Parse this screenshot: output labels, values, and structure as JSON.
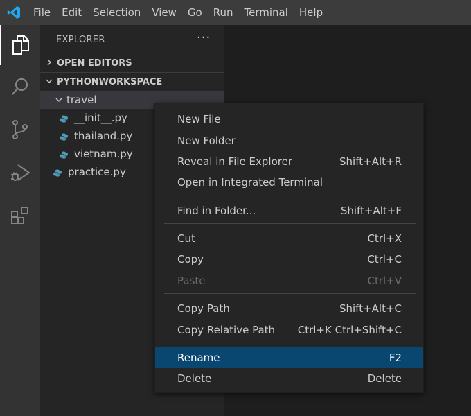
{
  "menubar": {
    "items": [
      "File",
      "Edit",
      "Selection",
      "View",
      "Go",
      "Run",
      "Terminal",
      "Help"
    ]
  },
  "activity_bar": {
    "icons": [
      "files-icon",
      "search-icon",
      "source-control-icon",
      "run-debug-icon",
      "extensions-icon"
    ]
  },
  "sidebar": {
    "title": "EXPLORER",
    "more": "···",
    "open_editors": "OPEN EDITORS",
    "workspace": "PYTHONWORKSPACE",
    "tree": [
      {
        "label": "travel",
        "type": "folder"
      },
      {
        "label": "__init__.py",
        "type": "python"
      },
      {
        "label": "thailand.py",
        "type": "python"
      },
      {
        "label": "vietnam.py",
        "type": "python"
      },
      {
        "label": "practice.py",
        "type": "python"
      }
    ]
  },
  "context_menu": {
    "items": [
      {
        "label": "New File",
        "shortcut": ""
      },
      {
        "label": "New Folder",
        "shortcut": ""
      },
      {
        "label": "Reveal in File Explorer",
        "shortcut": "Shift+Alt+R"
      },
      {
        "label": "Open in Integrated Terminal",
        "shortcut": ""
      },
      {
        "label": "Find in Folder...",
        "shortcut": "Shift+Alt+F"
      },
      {
        "label": "Cut",
        "shortcut": "Ctrl+X"
      },
      {
        "label": "Copy",
        "shortcut": "Ctrl+C"
      },
      {
        "label": "Paste",
        "shortcut": "Ctrl+V"
      },
      {
        "label": "Copy Path",
        "shortcut": "Shift+Alt+C"
      },
      {
        "label": "Copy Relative Path",
        "shortcut": "Ctrl+K Ctrl+Shift+C"
      },
      {
        "label": "Rename",
        "shortcut": "F2"
      },
      {
        "label": "Delete",
        "shortcut": "Delete"
      }
    ]
  },
  "colors": {
    "accent": "#007acc",
    "highlight": "#094771",
    "python_blue": "#519aba"
  }
}
